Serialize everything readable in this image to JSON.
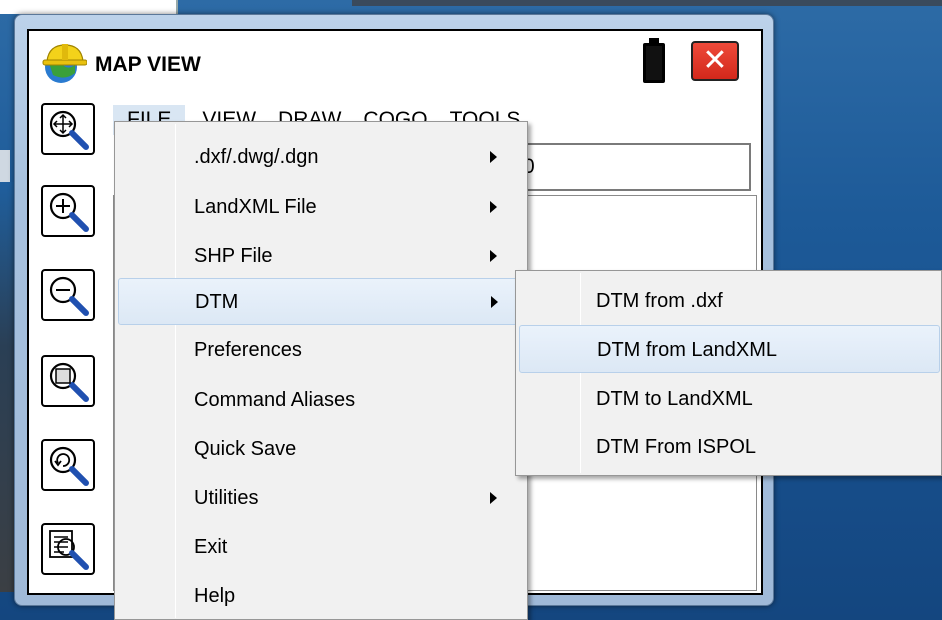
{
  "window": {
    "title": "MAP VIEW",
    "close_label": "✕",
    "coordinate_value": "0"
  },
  "menubar": {
    "items": [
      "FILE",
      "VIEW",
      "DRAW",
      "COGO",
      "TOOLS"
    ],
    "active": "FILE"
  },
  "toolbar": {
    "buttons": [
      {
        "icon": "zoom-extents-icon"
      },
      {
        "icon": "zoom-in-icon"
      },
      {
        "icon": "zoom-out-icon"
      },
      {
        "icon": "zoom-window-icon"
      },
      {
        "icon": "zoom-previous-icon"
      },
      {
        "icon": "zoom-list-icon"
      }
    ]
  },
  "file_menu": {
    "items": [
      {
        "label": ".dxf/.dwg/.dgn",
        "has_submenu": true
      },
      {
        "label": "LandXML File",
        "has_submenu": true
      },
      {
        "label": "SHP File",
        "has_submenu": true
      },
      {
        "label": "DTM",
        "has_submenu": true,
        "highlighted": true
      },
      {
        "label": "Preferences",
        "has_submenu": false
      },
      {
        "label": "Command Aliases",
        "has_submenu": false
      },
      {
        "label": "Quick Save",
        "has_submenu": false
      },
      {
        "label": "Utilities",
        "has_submenu": true
      },
      {
        "label": "Exit",
        "has_submenu": false
      },
      {
        "label": "Help",
        "has_submenu": false
      }
    ]
  },
  "dtm_submenu": {
    "items": [
      {
        "label": "DTM from .dxf"
      },
      {
        "label": "DTM from LandXML",
        "highlighted": true
      },
      {
        "label": "DTM to LandXML"
      },
      {
        "label": "DTM From ISPOL"
      }
    ]
  },
  "colors": {
    "close_button": "#d2281b",
    "menu_highlight": "#dce8f5",
    "window_frame": "#a7c1de"
  }
}
